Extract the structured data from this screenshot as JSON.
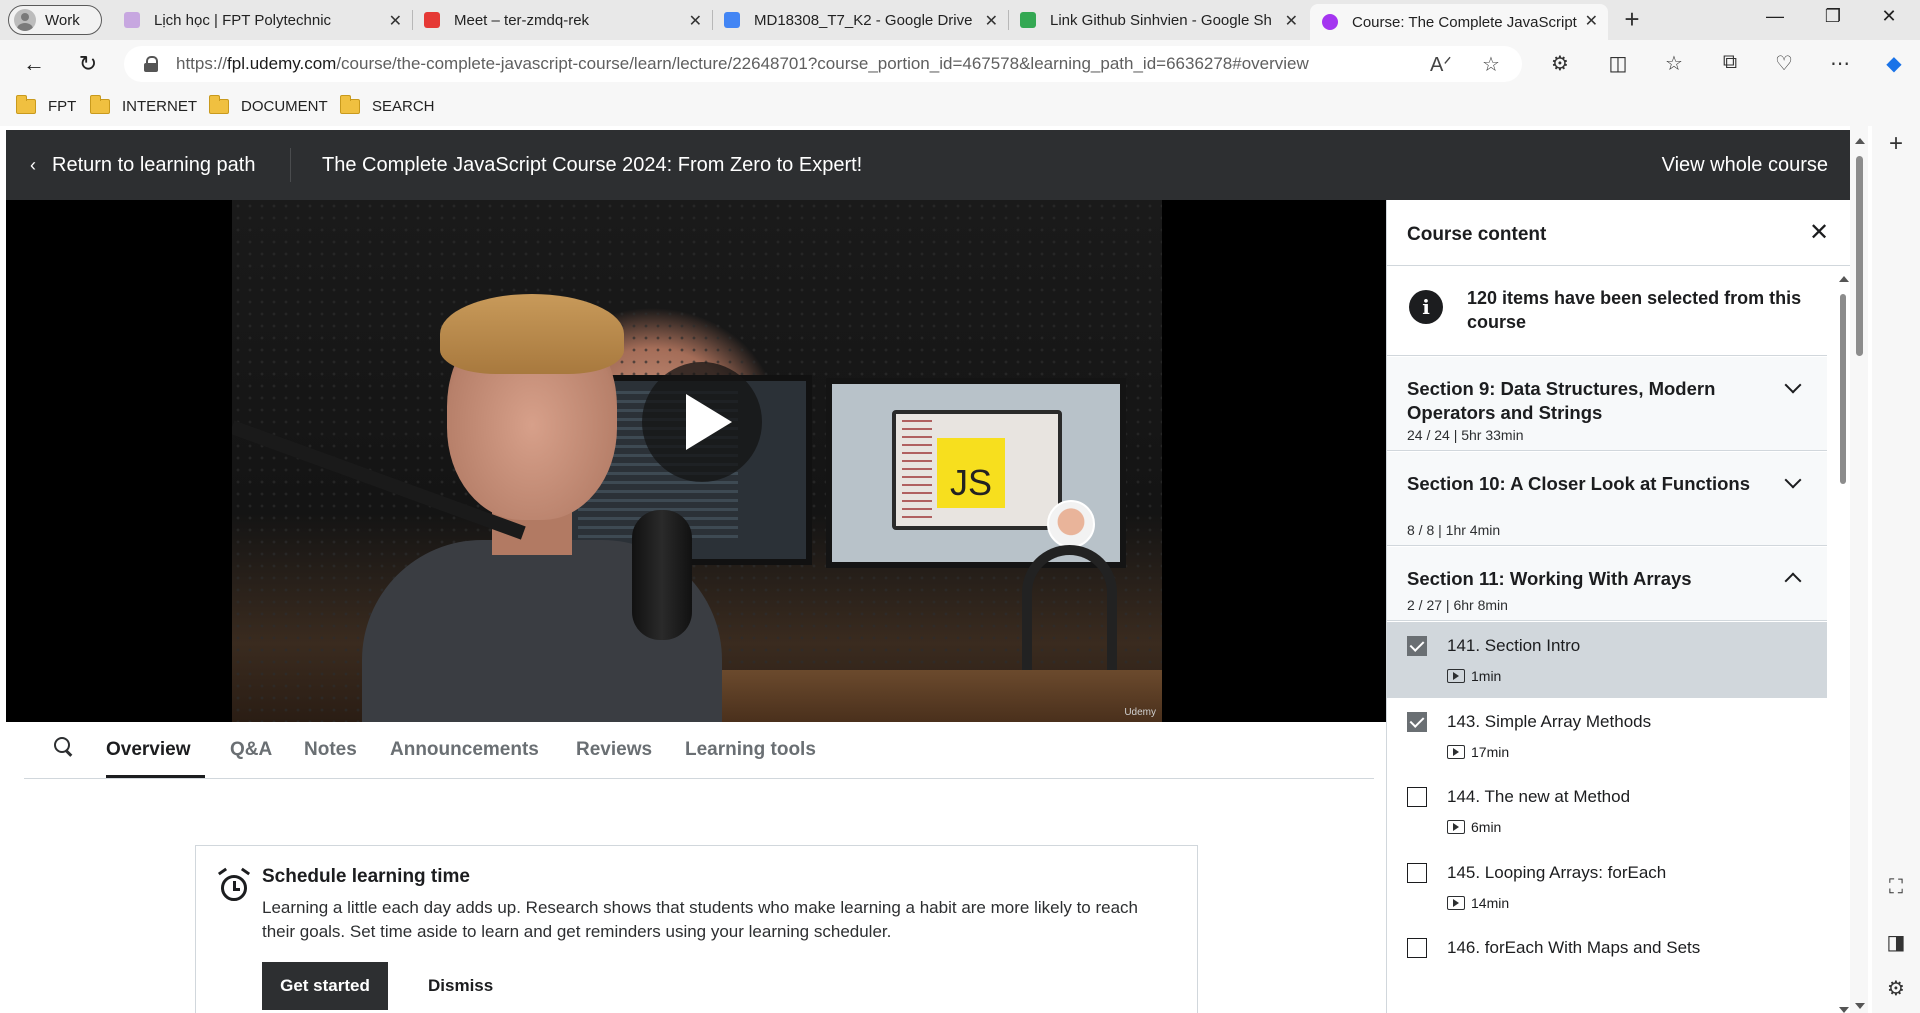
{
  "browser": {
    "profile": "Work",
    "tabs": [
      {
        "title": "Lịch học | FPT Polytechnic",
        "color": "#c7a7e0"
      },
      {
        "title": "Meet – ter-zmdq-rek",
        "color": "#e53935"
      },
      {
        "title": "MD18308_T7_K2 - Google Drive",
        "color": "#4285f4"
      },
      {
        "title": "Link Github Sinhvien - Google Sh",
        "color": "#34a853"
      },
      {
        "title": "Course: The Complete JavaScript",
        "color": "#a435f0"
      }
    ],
    "url_prefix": "https://",
    "url_host": "fpl.udemy.com",
    "url_path": "/course/the-complete-javascript-course/learn/lecture/22648701?course_portion_id=467578&learning_path_id=6636278#overview",
    "bookmarks": [
      "FPT",
      "INTERNET",
      "DOCUMENT",
      "SEARCH"
    ]
  },
  "header": {
    "back_label": "Return to learning path",
    "course_title": "The Complete JavaScript Course 2024: From Zero to Expert!",
    "view_whole": "View whole course"
  },
  "video": {
    "badge_text": "JS",
    "watermark": "Udemy"
  },
  "tabs": [
    "Overview",
    "Q&A",
    "Notes",
    "Announcements",
    "Reviews",
    "Learning tools"
  ],
  "schedule": {
    "title": "Schedule learning time",
    "body": "Learning a little each day adds up. Research shows that students who make learning a habit are more likely to reach their goals. Set time aside to learn and get reminders using your learning scheduler.",
    "primary": "Get started",
    "secondary": "Dismiss"
  },
  "sidebar": {
    "title": "Course content",
    "notice": "120 items have been selected from this course",
    "sections": [
      {
        "title": "Section 9: Data Structures, Modern Operators and Strings",
        "meta": "24 / 24 | 5hr 33min",
        "expanded": false
      },
      {
        "title": "Section 10: A Closer Look at Functions",
        "meta": "8 / 8 | 1hr 4min",
        "expanded": false
      },
      {
        "title": "Section 11: Working With Arrays",
        "meta": "2 / 27 | 6hr 8min",
        "expanded": true
      }
    ],
    "lectures": [
      {
        "title": "141. Section Intro",
        "duration": "1min",
        "checked": true,
        "current": true
      },
      {
        "title": "143. Simple Array Methods",
        "duration": "17min",
        "checked": true,
        "current": false
      },
      {
        "title": "144. The new at Method",
        "duration": "6min",
        "checked": false,
        "current": false
      },
      {
        "title": "145. Looping Arrays: forEach",
        "duration": "14min",
        "checked": false,
        "current": false
      },
      {
        "title": "146. forEach With Maps and Sets",
        "duration": "",
        "checked": false,
        "current": false
      }
    ]
  }
}
